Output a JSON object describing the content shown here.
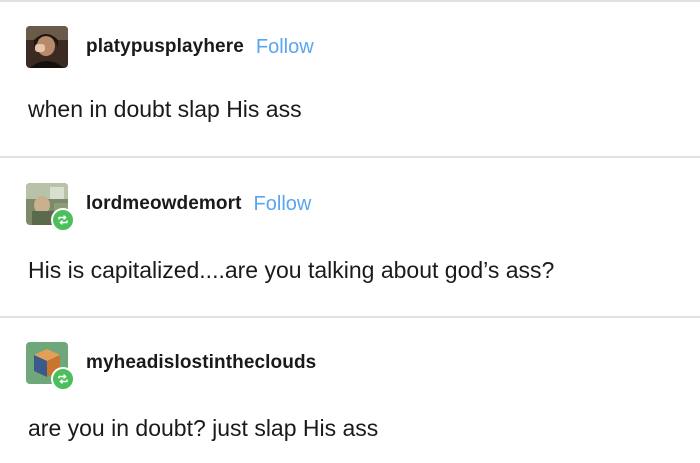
{
  "posts": [
    {
      "username": "platypusplayhere",
      "follow_label": "Follow",
      "text": "when in doubt slap His ass",
      "avatar_icon": "user-photo-avatar",
      "reblogged": false
    },
    {
      "username": "lordmeowdemort",
      "follow_label": "Follow",
      "text": "His is capitalized....are you talking about god’s ass?",
      "avatar_icon": "user-photo-avatar",
      "reblogged": true
    },
    {
      "username": "myheadislostintheclouds",
      "text": "are you in doubt? just slap His ass",
      "avatar_icon": "cube-avatar",
      "reblogged": true
    }
  ],
  "colors": {
    "follow_link": "#5aa5f0",
    "reblog_badge": "#4bbf5a",
    "divider": "#e2e2e2"
  }
}
